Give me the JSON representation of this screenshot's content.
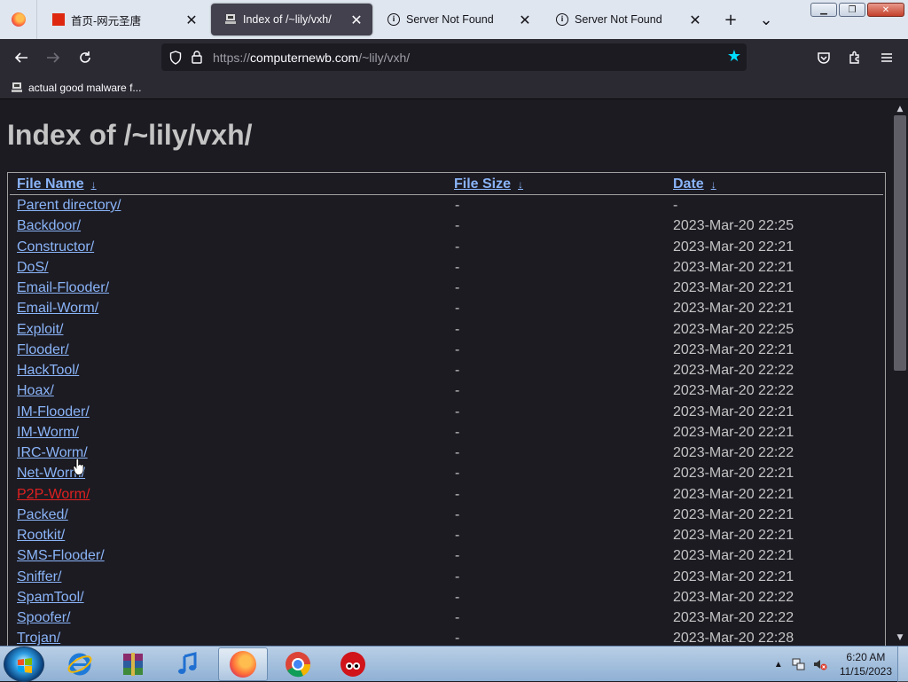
{
  "browser": {
    "tabs": [
      {
        "title": "首页-网元圣唐",
        "icon": "cn-flag-favicon",
        "close": "✕"
      },
      {
        "title": "Index of /~lily/vxh/",
        "icon": "vxh-favicon",
        "close": "✕"
      },
      {
        "title": "Server Not Found",
        "icon": "info-icon",
        "close": "✕"
      },
      {
        "title": "Server Not Found",
        "icon": "info-icon",
        "close": "✕"
      }
    ],
    "new_tab": "+",
    "tab_list": "⌄",
    "url": {
      "scheme": "https://",
      "host": "computernewb.com",
      "path": "/~lily/vxh/"
    },
    "bookmarks": [
      {
        "label": "actual good malware f..."
      }
    ],
    "colors": {
      "accent": "#00ddff",
      "link": "#8ab4f8",
      "visited_link": "#e02020",
      "page_bg": "#1c1b22"
    }
  },
  "page": {
    "title": "Index of /~lily/vxh/",
    "columns": {
      "name": "File Name",
      "size": "File Size",
      "date": "Date",
      "sort_arrow": "↓"
    },
    "rows": [
      {
        "name": "Parent directory/",
        "size": "-",
        "date": "-"
      },
      {
        "name": "Backdoor/",
        "size": "-",
        "date": "2023-Mar-20 22:25"
      },
      {
        "name": "Constructor/",
        "size": "-",
        "date": "2023-Mar-20 22:21"
      },
      {
        "name": "DoS/",
        "size": "-",
        "date": "2023-Mar-20 22:21"
      },
      {
        "name": "Email-Flooder/",
        "size": "-",
        "date": "2023-Mar-20 22:21"
      },
      {
        "name": "Email-Worm/",
        "size": "-",
        "date": "2023-Mar-20 22:21"
      },
      {
        "name": "Exploit/",
        "size": "-",
        "date": "2023-Mar-20 22:25"
      },
      {
        "name": "Flooder/",
        "size": "-",
        "date": "2023-Mar-20 22:21"
      },
      {
        "name": "HackTool/",
        "size": "-",
        "date": "2023-Mar-20 22:22"
      },
      {
        "name": "Hoax/",
        "size": "-",
        "date": "2023-Mar-20 22:22"
      },
      {
        "name": "IM-Flooder/",
        "size": "-",
        "date": "2023-Mar-20 22:21"
      },
      {
        "name": "IM-Worm/",
        "size": "-",
        "date": "2023-Mar-20 22:21"
      },
      {
        "name": "IRC-Worm/",
        "size": "-",
        "date": "2023-Mar-20 22:22"
      },
      {
        "name": "Net-Worm/",
        "size": "-",
        "date": "2023-Mar-20 22:21"
      },
      {
        "name": "P2P-Worm/",
        "size": "-",
        "date": "2023-Mar-20 22:21",
        "visited": true
      },
      {
        "name": "Packed/",
        "size": "-",
        "date": "2023-Mar-20 22:21"
      },
      {
        "name": "Rootkit/",
        "size": "-",
        "date": "2023-Mar-20 22:21"
      },
      {
        "name": "SMS-Flooder/",
        "size": "-",
        "date": "2023-Mar-20 22:21"
      },
      {
        "name": "Sniffer/",
        "size": "-",
        "date": "2023-Mar-20 22:21"
      },
      {
        "name": "SpamTool/",
        "size": "-",
        "date": "2023-Mar-20 22:22"
      },
      {
        "name": "Spoofer/",
        "size": "-",
        "date": "2023-Mar-20 22:22"
      },
      {
        "name": "Trojan/",
        "size": "-",
        "date": "2023-Mar-20 22:28"
      }
    ]
  },
  "taskbar": {
    "apps": [
      {
        "name": "internet-explorer-icon"
      },
      {
        "name": "winrar-icon"
      },
      {
        "name": "itunes-icon"
      },
      {
        "name": "firefox-icon",
        "active": true
      },
      {
        "name": "chrome-icon"
      },
      {
        "name": "red-character-icon"
      }
    ],
    "clock": {
      "time": "6:20 AM",
      "date": "11/15/2023"
    }
  }
}
